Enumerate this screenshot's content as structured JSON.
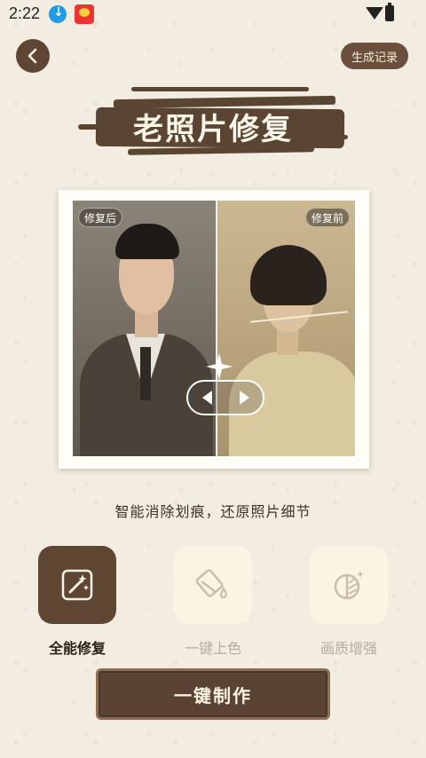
{
  "status_bar": {
    "time": "2:22"
  },
  "header": {
    "history_label": "生成记录",
    "title": "老照片修复"
  },
  "preview": {
    "after_tag": "修复后",
    "before_tag": "修复前",
    "slider_position": 0.5
  },
  "subtitle": "智能消除划痕，还原照片细节",
  "features": [
    {
      "label": "全能修复",
      "icon": "magic-restore-icon",
      "active": true
    },
    {
      "label": "一键上色",
      "icon": "paint-bucket-icon",
      "active": false
    },
    {
      "label": "画质增强",
      "icon": "contrast-enhance-icon",
      "active": false
    }
  ],
  "action": {
    "make_label": "一键制作"
  },
  "colors": {
    "background": "#f2ece1",
    "primary_brown": "#5e4632",
    "tile_inactive": "#fbf3e3",
    "inactive_text": "#b5aba0"
  }
}
